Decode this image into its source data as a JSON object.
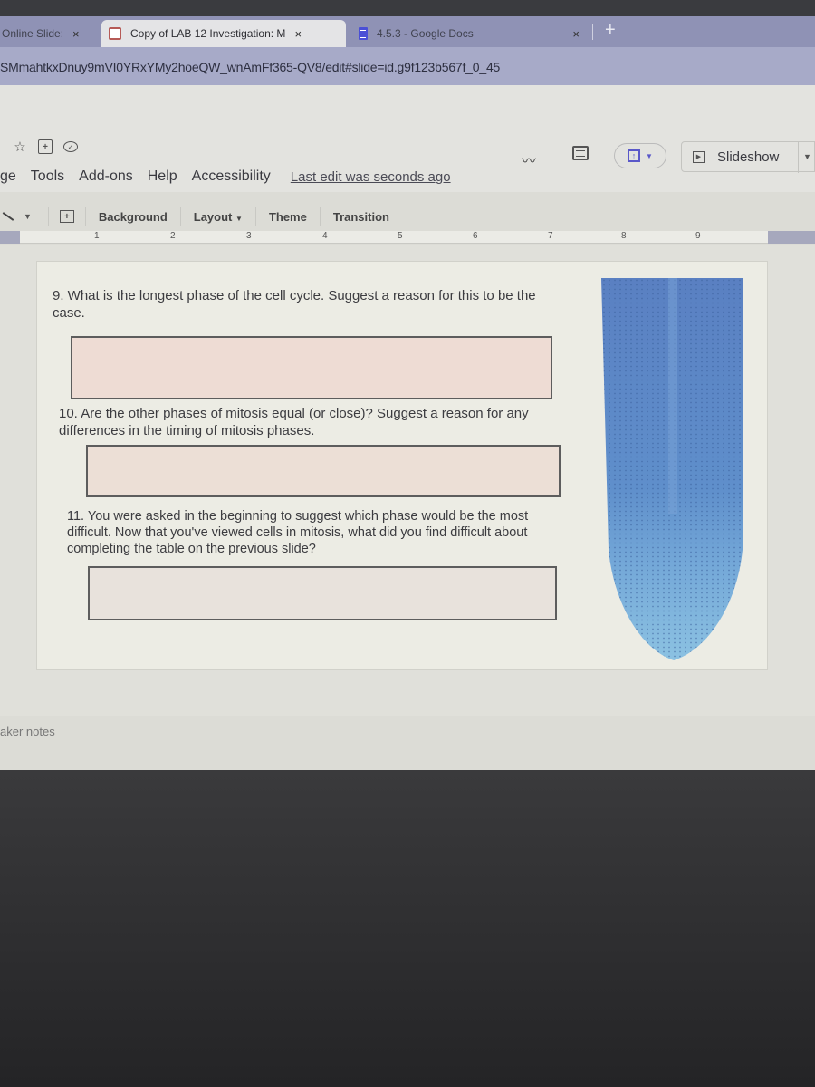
{
  "browser": {
    "tabs": [
      {
        "label": "Online Slide:",
        "active": false
      },
      {
        "label": "Copy of LAB 12 Investigation: M",
        "active": true
      },
      {
        "label": "4.5.3 - Google Docs",
        "active": false
      }
    ],
    "close_glyph": "×",
    "new_tab_glyph": "+",
    "url": "SMmahtkxDnuy9mVI0YRxYMy2hoeQW_wnAmFf365-QV8/edit#slide=id.g9f123b567f_0_45"
  },
  "header": {
    "icons": [
      "star-icon",
      "move-to-folder-icon",
      "cloud-saved-icon"
    ],
    "menu": [
      "ge",
      "Tools",
      "Add-ons",
      "Help",
      "Accessibility"
    ],
    "last_edit": "Last edit was seconds ago",
    "slideshow_label": "Slideshow"
  },
  "toolbar": {
    "items": [
      "Background",
      "Layout",
      "Theme",
      "Transition"
    ]
  },
  "ruler": {
    "numbers": [
      "1",
      "2",
      "3",
      "4",
      "5",
      "6",
      "7",
      "8",
      "9"
    ]
  },
  "slide": {
    "questions": [
      {
        "text": "9. What is the longest phase of the cell cycle.  Suggest a reason for this to be the case.",
        "answer": ""
      },
      {
        "text": "10. Are the other phases of mitosis equal (or close)?  Suggest a reason for any differences in the timing of mitosis phases.",
        "answer": ""
      },
      {
        "text": "11. You were asked in the beginning to suggest which phase would be the most difficult. Now that you've viewed cells in mitosis, what did you find difficult about completing the table on the previous slide?",
        "answer": ""
      }
    ],
    "image": "root-tip-micrograph",
    "colors": {
      "answer_fill": "#eedcd4",
      "image_blue": "#5b85c4"
    }
  },
  "speaker_notes": {
    "label": "aker notes"
  }
}
